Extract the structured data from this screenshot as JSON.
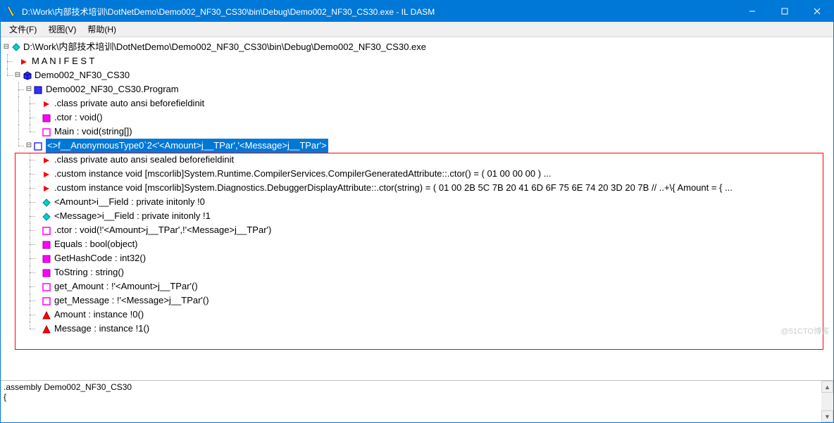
{
  "titlebar": {
    "title": "D:\\Work\\内部技术培训\\DotNetDemo\\Demo002_NF30_CS30\\bin\\Debug\\Demo002_NF30_CS30.exe - IL DASM"
  },
  "menubar": {
    "file": "文件(F)",
    "view": "视图(V)",
    "help": "帮助(H)"
  },
  "tree": {
    "root": "D:\\Work\\内部技术培训\\DotNetDemo\\Demo002_NF30_CS30\\bin\\Debug\\Demo002_NF30_CS30.exe",
    "manifest": "M A N I F E S T",
    "ns": "Demo002_NF30_CS30",
    "program": "Demo002_NF30_CS30.Program",
    "program_members": {
      "class": ".class private auto ansi beforefieldinit",
      "ctor": ".ctor : void()",
      "main": "Main : void(string[])"
    },
    "anon": {
      "name": "<>f__AnonymousType0`2<'<Amount>j__TPar','<Message>j__TPar'>",
      "class": ".class private auto ansi sealed beforefieldinit",
      "custom1": ".custom instance void [mscorlib]System.Runtime.CompilerServices.CompilerGeneratedAttribute::.ctor() = ( 01 00 00 00 )  ...",
      "custom2": ".custom instance void [mscorlib]System.Diagnostics.DebuggerDisplayAttribute::.ctor(string) = ( 01 00 2B 5C 7B 20 41 6D 6F 75 6E 74 20 3D 20 7B   // ..+\\{ Amount = { ...",
      "field1": "<Amount>i__Field : private initonly !0",
      "field2": "<Message>i__Field : private initonly !1",
      "ctor": ".ctor : void(!'<Amount>j__TPar',!'<Message>j__TPar')",
      "equals": "Equals : bool(object)",
      "gethash": "GetHashCode : int32()",
      "tostring": "ToString : string()",
      "get_amount": "get_Amount : !'<Amount>j__TPar'()",
      "get_message": "get_Message : !'<Message>j__TPar'()",
      "prop_amount": "Amount : instance !0()",
      "prop_message": "Message : instance !1()"
    }
  },
  "bottom": {
    "text": ".assembly Demo002_NF30_CS30\n{"
  },
  "watermark": "@51CTO博客"
}
